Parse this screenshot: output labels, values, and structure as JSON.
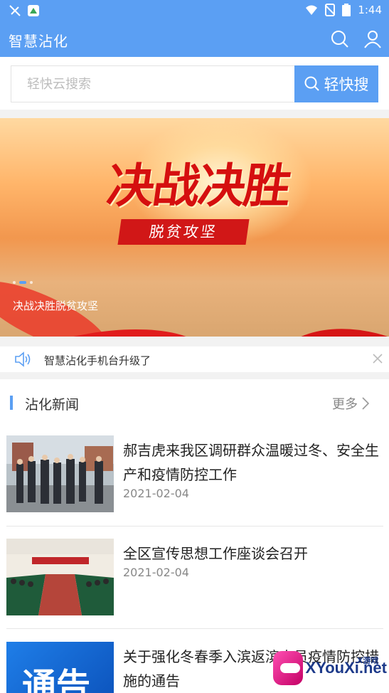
{
  "status_bar": {
    "time": "1:44"
  },
  "app_bar": {
    "title": "智慧沾化"
  },
  "search": {
    "placeholder": "轻快云搜索",
    "button_label": "轻快搜"
  },
  "banner": {
    "headline": "决战决胜",
    "subhead": "脱贫攻坚",
    "caption": "决战决胜脱贫攻坚",
    "slide_index": 2,
    "slide_count": 3
  },
  "notice": {
    "text": "智慧沾化手机台升级了"
  },
  "news_section": {
    "title": "沾化新闻",
    "more_label": "更多",
    "items": [
      {
        "headline": "郝吉虎来我区调研群众温暖过冬、安全生产和疫情防控工作",
        "date": "2021-02-04"
      },
      {
        "headline": "全区宣传思想工作座谈会召开",
        "date": "2021-02-04"
      },
      {
        "headline": "关于强化冬春季入滨返滨人员疫情防控措施的通告",
        "date": ""
      }
    ],
    "thumb3_text": "通告"
  },
  "watermark": {
    "text": "XYouXi.net",
    "small": "X游戏"
  },
  "colors": {
    "accent": "#5b9ff3",
    "banner_red": "#d50f0f"
  },
  "icons": [
    "signal-mute-icon",
    "app-notification-icon",
    "wifi-icon",
    "no-sim-icon",
    "battery-icon",
    "search-icon",
    "user-icon",
    "speaker-icon",
    "close-icon",
    "chevron-right-icon"
  ]
}
